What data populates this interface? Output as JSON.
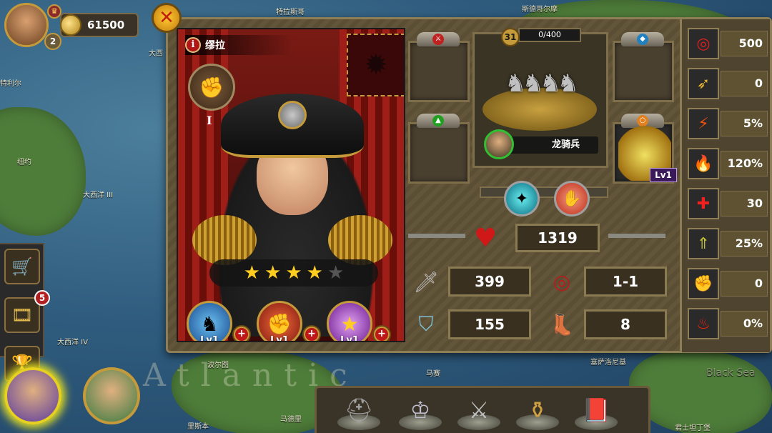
{
  "hud": {
    "coins": "61500",
    "player_level": "2",
    "close_label": "✕",
    "crown": "♛"
  },
  "map": {
    "labels": [
      "特拉斯哥",
      "斯德哥尔摩",
      "大西洋 III",
      "大西洋 IV",
      "纽约",
      "特利尔",
      "波尔图",
      "马赛",
      "塞萨洛尼基",
      "马德里",
      "里斯本",
      "君士坦丁堡",
      "大西"
    ],
    "big_text": "Atlantic",
    "black_sea": "Black Sea"
  },
  "side": {
    "shop_icon": "🛒",
    "video_icon": "🎞",
    "video_badge": "5",
    "trophy_icon": "🏆"
  },
  "hero": {
    "name": "缪拉",
    "info_label": "i",
    "trait_rank": "I",
    "stars_filled": 4,
    "stars_total": 5,
    "skills": [
      {
        "name": "horse-skill",
        "level": "Lv1",
        "color": "#2a7ad0"
      },
      {
        "name": "fist-skill",
        "level": "Lv1",
        "color": "#c03a18"
      },
      {
        "name": "star-skill",
        "level": "Lv1",
        "color": "#8a3ac0"
      }
    ]
  },
  "troop": {
    "level": "31",
    "xp": "0/400",
    "name": "龙骑兵"
  },
  "equipment": {
    "potion_level": "Lv1"
  },
  "stats": {
    "hp": "1319",
    "attack": "399",
    "range": "1-1",
    "defense": "155",
    "speed": "8"
  },
  "right_stats": [
    {
      "icon": "target-icon",
      "value": "500",
      "color": "#c01818"
    },
    {
      "icon": "wing-icon",
      "value": "0",
      "color": "#d0a020"
    },
    {
      "icon": "lightning-icon",
      "value": "5%",
      "color": "#e04010"
    },
    {
      "icon": "sword-fire-icon",
      "value": "120%",
      "color": "#e04010"
    },
    {
      "icon": "health-cross-icon",
      "value": "30",
      "color": "#e02020"
    },
    {
      "icon": "rank-up-icon",
      "value": "25%",
      "color": "#a0a020"
    },
    {
      "icon": "fist-fire-icon",
      "value": "0",
      "color": "#c02010"
    },
    {
      "icon": "burning-man-icon",
      "value": "0%",
      "color": "#e02010"
    }
  ],
  "colors": {
    "panel_bg": "#5e5232",
    "panel_border": "#8e7e56",
    "gold": "#c49a3a",
    "hp_red": "#d01818"
  }
}
